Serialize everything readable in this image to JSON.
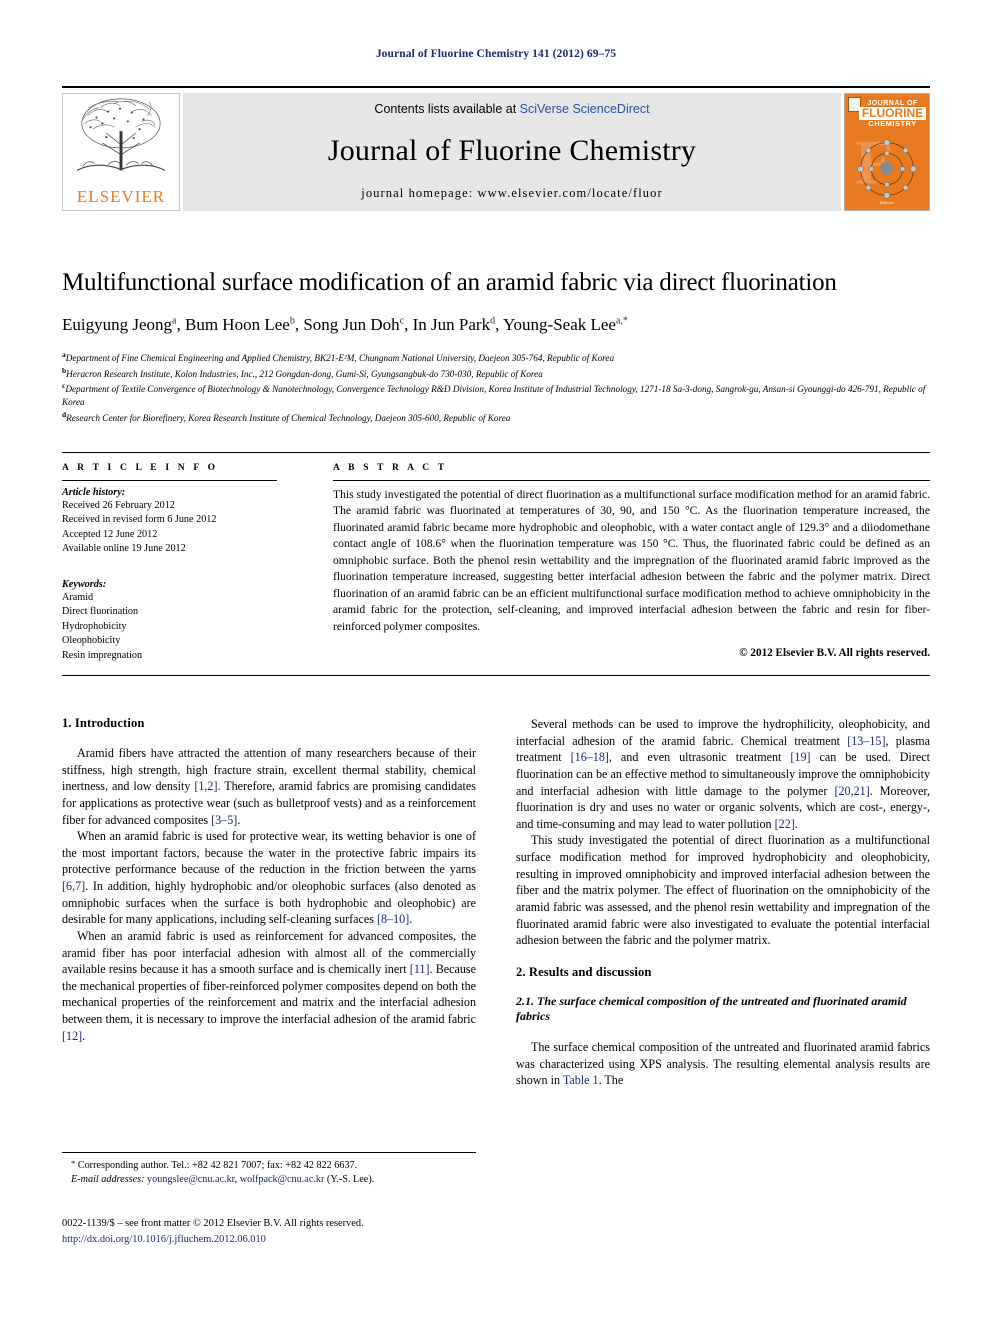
{
  "running_head": "Journal of Fluorine Chemistry 141 (2012) 69–75",
  "masthead": {
    "contents_prefix": "Contents lists available at ",
    "sciencedirect": "SciVerse ScienceDirect",
    "journal_title": "Journal of Fluorine Chemistry",
    "homepage": "journal homepage: www.elsevier.com/locate/fluor",
    "publisher_logo_text": "ELSEVIER",
    "cover": {
      "line1": "JOURNAL OF",
      "line2": "FLUORINE",
      "line3": "CHEMISTRY",
      "footer": "Elsevier"
    },
    "accent_orange": "#E87A22",
    "link_blue": "#2b50a0"
  },
  "article": {
    "title": "Multifunctional surface modification of an aramid fabric via direct fluorination",
    "authors": "Euigyung Jeong a, Bum Hoon Lee b, Song Jun Doh c, In Jun Park d, Young-Seak Lee a,*",
    "author_list": [
      {
        "name": "Euigyung Jeong",
        "sup": "a"
      },
      {
        "name": "Bum Hoon Lee",
        "sup": "b"
      },
      {
        "name": "Song Jun Doh",
        "sup": "c"
      },
      {
        "name": "In Jun Park",
        "sup": "d"
      },
      {
        "name": "Young-Seak Lee",
        "sup": "a,*"
      }
    ],
    "affiliations": [
      {
        "sup": "a",
        "text": "Department of Fine Chemical Engineering and Applied Chemistry, BK21-E²M, Chungnam National University, Daejeon 305-764, Republic of Korea"
      },
      {
        "sup": "b",
        "text": "Heracron Research Institute, Kolon Industries, Inc., 212 Gongdan-dong, Gumi-Si, Gyungsangbuk-do 730-030, Republic of Korea"
      },
      {
        "sup": "c",
        "text": "Department of Textile Convergence of Biotechnology & Nanotechnology, Convergence Technology R&D Division, Korea Institute of Industrial Technology, 1271-18 Sa-3-dong, Sangrok-gu, Ansan-si Gyounggi-do 426-791, Republic of Korea"
      },
      {
        "sup": "d",
        "text": "Research Center for Biorefinery, Korea Research Institute of Chemical Technology, Daejeon 305-600, Republic of Korea"
      }
    ]
  },
  "article_info": {
    "heading": "A R T I C L E   I N F O",
    "history_label": "Article history:",
    "history": [
      "Received 26 February 2012",
      "Received in revised form 6 June 2012",
      "Accepted 12 June 2012",
      "Available online 19 June 2012"
    ],
    "keywords_label": "Keywords:",
    "keywords": [
      "Aramid",
      "Direct fluorination",
      "Hydrophobicity",
      "Oleophobicity",
      "Resin impregnation"
    ]
  },
  "abstract": {
    "heading": "A B S T R A C T",
    "text": "This study investigated the potential of direct fluorination as a multifunctional surface modification method for an aramid fabric. The aramid fabric was fluorinated at temperatures of 30, 90, and 150 °C. As the fluorination temperature increased, the fluorinated aramid fabric became more hydrophobic and oleophobic, with a water contact angle of 129.3° and a diiodomethane contact angle of 108.6° when the fluorination temperature was 150 °C. Thus, the fluorinated fabric could be defined as an omniphobic surface. Both the phenol resin wettability and the impregnation of the fluorinated aramid fabric improved as the fluorination temperature increased, suggesting better interfacial adhesion between the fabric and the polymer matrix. Direct fluorination of an aramid fabric can be an efficient multifunctional surface modification method to achieve omniphobicity in the aramid fabric for the protection, self-cleaning, and improved interfacial adhesion between the fabric and resin for fiber-reinforced polymer composites.",
    "copyright": "© 2012 Elsevier B.V. All rights reserved."
  },
  "body": {
    "intro_heading": "1. Introduction",
    "intro_p1_a": "Aramid fibers have attracted the attention of many researchers because of their stiffness, high strength, high fracture strain, excellent thermal stability, chemical inertness, and low density ",
    "intro_p1_r1": "[1,2]",
    "intro_p1_b": ". Therefore, aramid fabrics are promising candidates for applications as protective wear (such as bulletproof vests) and as a reinforcement fiber for advanced composites ",
    "intro_p1_r2": "[3–5]",
    "intro_p1_c": ".",
    "intro_p2_a": "When an aramid fabric is used for protective wear, its wetting behavior is one of the most important factors, because the water in the protective fabric impairs its protective performance because of the reduction in the friction between the yarns ",
    "intro_p2_r1": "[6,7]",
    "intro_p2_b": ". In addition, highly hydrophobic and/or oleophobic surfaces (also denoted as omniphobic surfaces when the surface is both hydrophobic and oleophobic) are desirable for many applications, including self-cleaning surfaces ",
    "intro_p2_r2": "[8–10]",
    "intro_p2_c": ".",
    "intro_p3_a": "When an aramid fabric is used as reinforcement for advanced composites, the aramid fiber has poor interfacial adhesion with almost all of the commercially available resins because it has a smooth surface and is chemically inert ",
    "intro_p3_r1": "[11]",
    "intro_p3_b": ". Because the mechanical properties of fiber-reinforced polymer composites depend on both the mechanical properties of the reinforcement and matrix and the interfacial adhesion between them, it is necessary to improve the interfacial adhesion of the aramid fabric ",
    "intro_p3_r2": "[12]",
    "intro_p3_c": ".",
    "right_p1_a": "Several methods can be used to improve the hydrophilicity, oleophobicity, and interfacial adhesion of the aramid fabric. Chemical treatment ",
    "right_p1_r1": "[13–15]",
    "right_p1_b": ", plasma treatment ",
    "right_p1_r2": "[16–18]",
    "right_p1_c": ", and even ultrasonic treatment ",
    "right_p1_r3": "[19]",
    "right_p1_d": " can be used. Direct fluorination can be an effective method to simultaneously improve the omniphobicity and interfacial adhesion with little damage to the polymer ",
    "right_p1_r4": "[20,21]",
    "right_p1_e": ". Moreover, fluorination is dry and uses no water or organic solvents, which are cost-, energy-, and time-consuming and may lead to water pollution ",
    "right_p1_r5": "[22]",
    "right_p1_f": ".",
    "right_p2": "This study investigated the potential of direct fluorination as a multifunctional surface modification method for improved hydrophobicity and oleophobicity, resulting in improved omniphobicity and improved interfacial adhesion between the fiber and the matrix polymer. The effect of fluorination on the omniphobicity of the aramid fabric was assessed, and the phenol resin wettability and impregnation of the fluorinated aramid fabric were also investigated to evaluate the potential interfacial adhesion between the fabric and the polymer matrix.",
    "results_heading": "2. Results and discussion",
    "subsec_heading": "2.1. The surface chemical composition of the untreated and fluorinated aramid fabrics",
    "results_p1_a": "The surface chemical composition of the untreated and fluorinated aramid fabrics was characterized using XPS analysis. The resulting elemental analysis results are shown in ",
    "results_p1_link": "Table 1",
    "results_p1_b": ". The"
  },
  "footnote": {
    "corresponding": "Corresponding author. Tel.: +82 42 821 7007; fax: +82 42 822 6637.",
    "email_label": "E-mail addresses:",
    "email1": "youngslee@cnu.ac.kr",
    "email2": "wolfpack@cnu.ac.kr",
    "email_suffix": "(Y.-S. Lee)."
  },
  "imprint": {
    "line1": "0022-1139/$ – see front matter © 2012 Elsevier B.V. All rights reserved.",
    "doi": "http://dx.doi.org/10.1016/j.jfluchem.2012.06.010"
  }
}
